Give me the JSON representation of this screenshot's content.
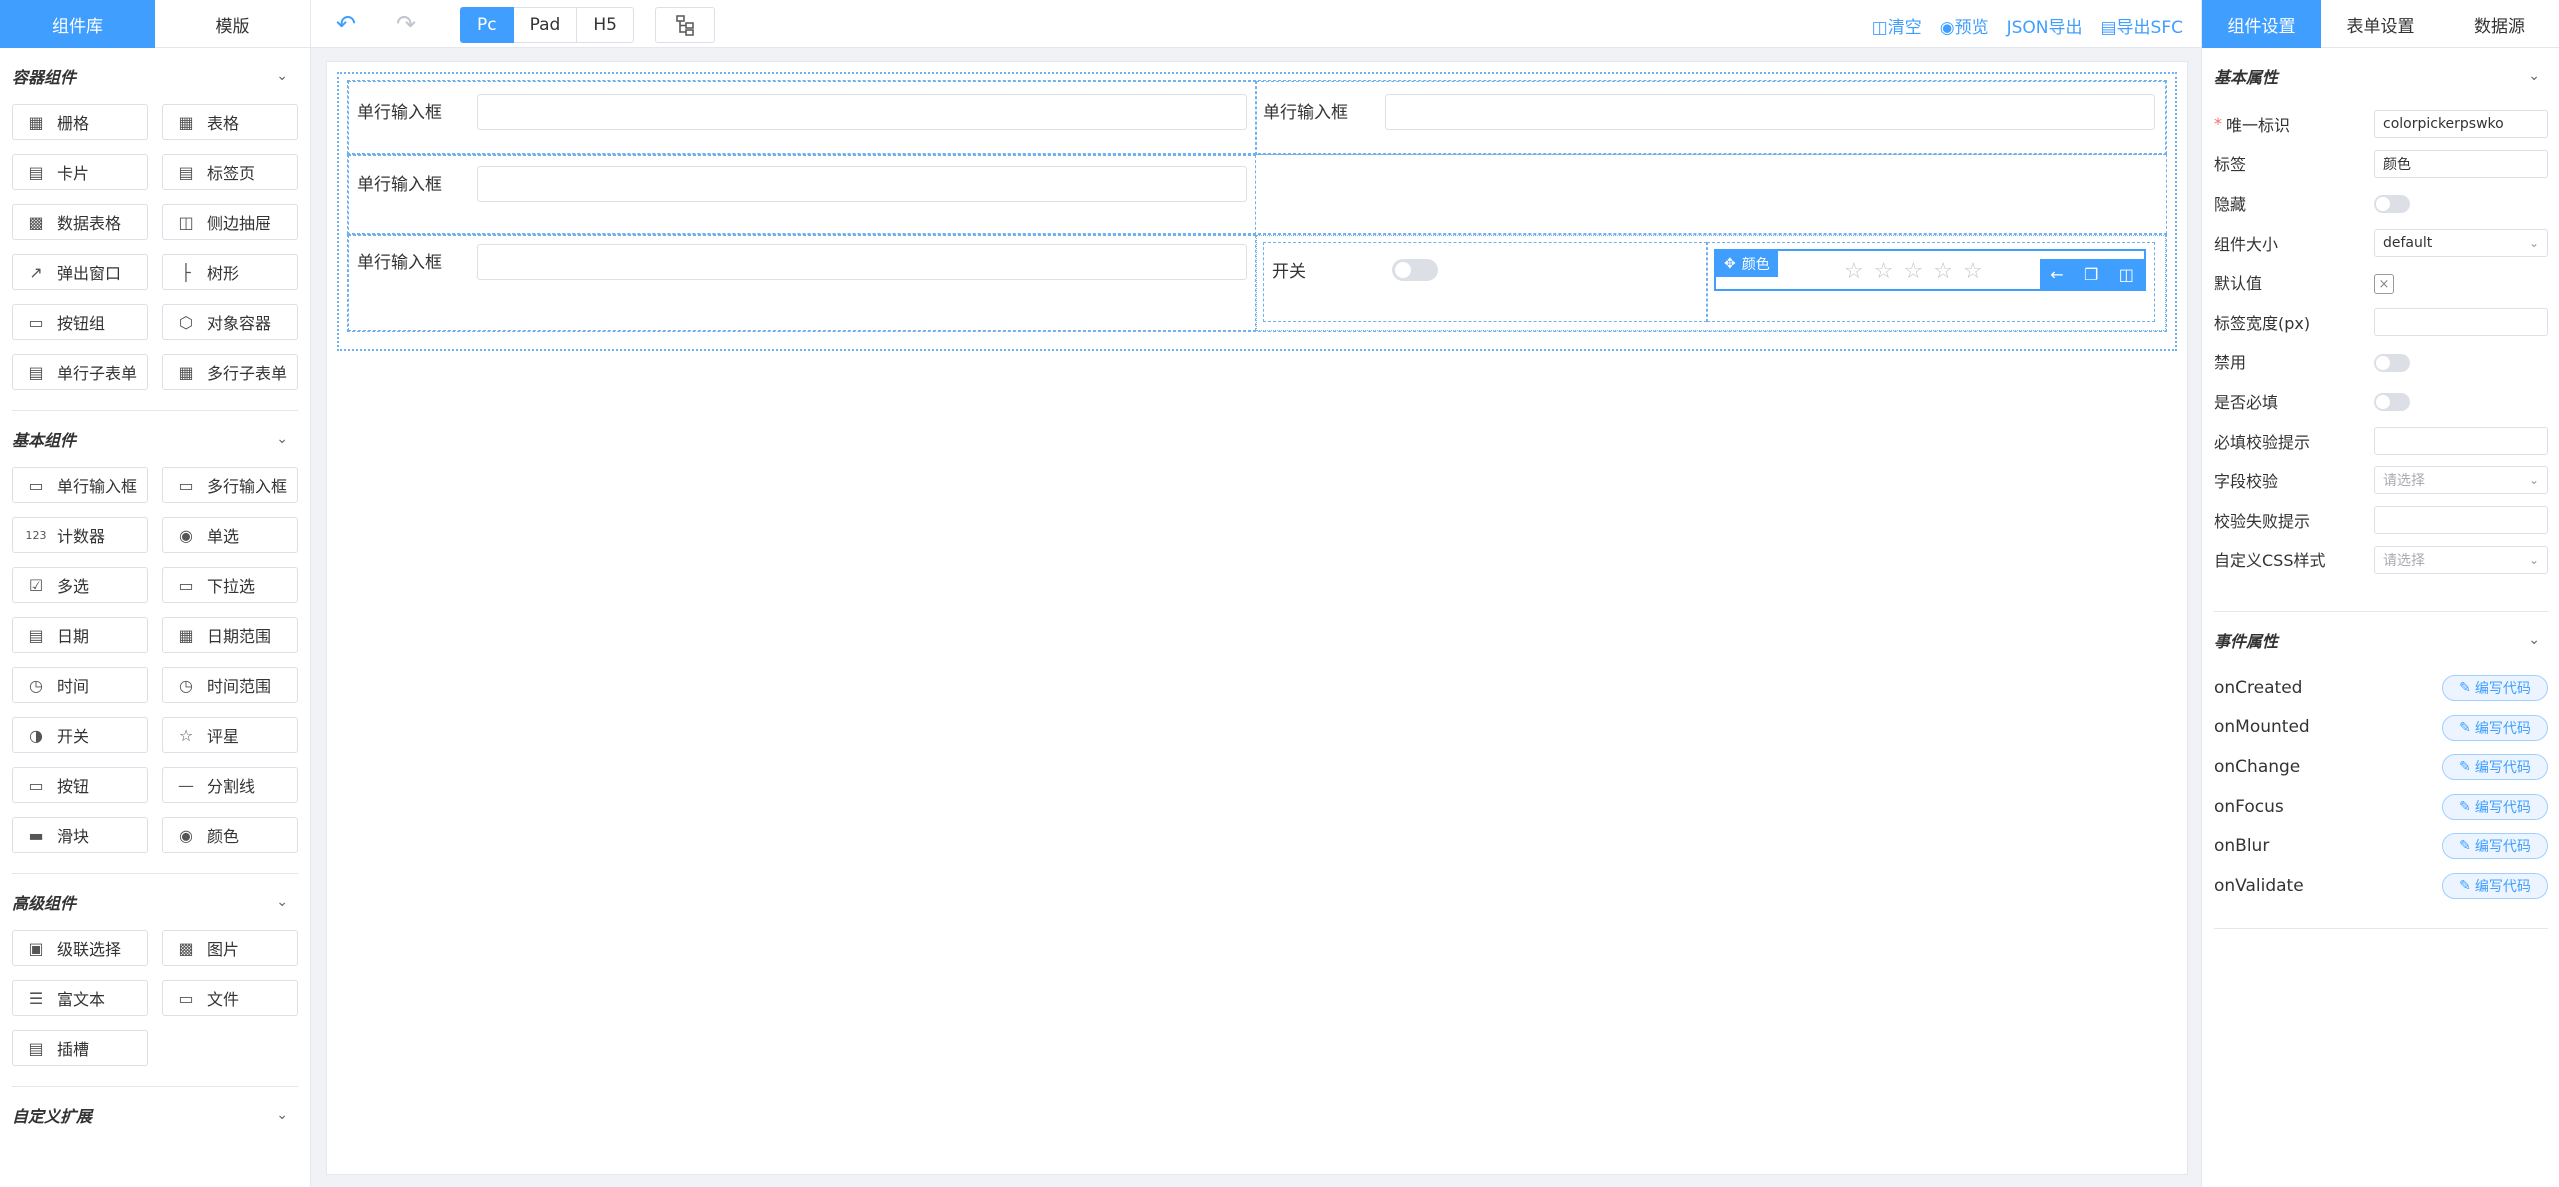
{
  "left_tabs": {
    "components": "组件库",
    "templates": "模版"
  },
  "container_section": {
    "title": "容器组件",
    "items": [
      "栅格",
      "表格",
      "卡片",
      "标签页",
      "数据表格",
      "侧边抽屉",
      "弹出窗口",
      "树形",
      "按钮组",
      "对象容器",
      "单行子表单",
      "多行子表单"
    ]
  },
  "basic_section": {
    "title": "基本组件",
    "items": [
      "单行输入框",
      "多行输入框",
      "计数器",
      "单选",
      "多选",
      "下拉选",
      "日期",
      "日期范围",
      "时间",
      "时间范围",
      "开关",
      "评星",
      "按钮",
      "分割线",
      "滑块",
      "颜色"
    ]
  },
  "advanced_section": {
    "title": "高级组件",
    "items": [
      "级联选择",
      "图片",
      "富文本",
      "文件",
      "插槽"
    ]
  },
  "custom_section": {
    "title": "自定义扩展"
  },
  "toolbar": {
    "devices": [
      "Pc",
      "Pad",
      "H5"
    ],
    "actions": {
      "clear": "清空",
      "preview": "预览",
      "export_json": "JSON导出",
      "export_sfc": "导出SFC"
    }
  },
  "form": {
    "input_label": "单行输入框",
    "switch_label": "开关",
    "selected_tag": "颜色"
  },
  "right_tabs": {
    "component": "组件设置",
    "form": "表单设置",
    "datasource": "数据源"
  },
  "props": {
    "title": "基本属性",
    "unique_id_label": "唯一标识",
    "unique_id_value": "colorpickerpswko",
    "label_label": "标签",
    "label_value": "颜色",
    "hidden_label": "隐藏",
    "size_label": "组件大小",
    "size_value": "default",
    "default_label": "默认值",
    "label_width_label": "标签宽度(px)",
    "disabled_label": "禁用",
    "required_label": "是否必填",
    "required_msg_label": "必填校验提示",
    "validation_label": "字段校验",
    "validation_placeholder": "请选择",
    "fail_msg_label": "校验失败提示",
    "css_label": "自定义CSS样式",
    "css_placeholder": "请选择"
  },
  "events": {
    "title": "事件属性",
    "button_label": "编写代码",
    "items": [
      "onCreated",
      "onMounted",
      "onChange",
      "onFocus",
      "onBlur",
      "onValidate"
    ]
  },
  "colors": {
    "primary": "#409eff",
    "border": "#dcdfe6",
    "required": "#f56c6c"
  }
}
